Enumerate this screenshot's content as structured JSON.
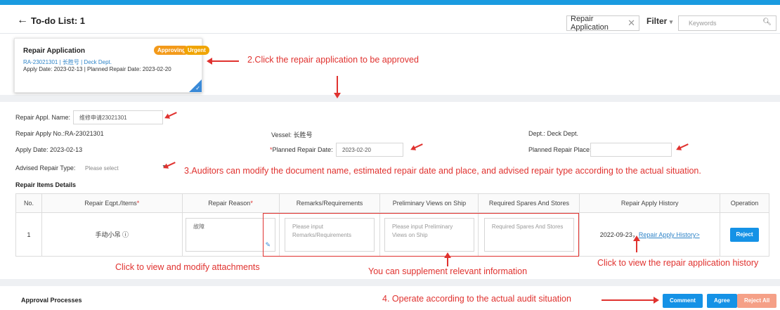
{
  "header": {
    "back_label": "To-do List: 1",
    "filter_chip": "Repair Application",
    "filter_label": "Filter",
    "keywords_placeholder": "Keywords"
  },
  "card": {
    "title": "Repair Application",
    "badge_approving": "Approving",
    "badge_urgent": "Urgent",
    "line2": "RA-23021301  |  长胜号  |  Deck Dept.",
    "line3": "Apply Date: 2023-02-13 | Planned Repair Date: 2023-02-20"
  },
  "annotations": {
    "step2": "2.Click the repair application to be approved",
    "step3": "3.Auditors can modify the document name, estimated repair date and place, and advised repair type according to the actual situation.",
    "attachments": "Click to view and modify attachments",
    "supplement": "You can supplement relevant information",
    "history": "Click to view the repair application history",
    "step4": "4. Operate according to the actual audit situation"
  },
  "form": {
    "appl_name_label": "Repair Appl. Name:",
    "appl_name_value": "维修申请23021301",
    "apply_no_label": "Repair Apply No.:",
    "apply_no_value": "RA-23021301",
    "vessel_label": "Vessel:",
    "vessel_value": "长胜号",
    "dept_label": "Dept.:",
    "dept_value": "Deck Dept.",
    "apply_date_label": "Apply Date:",
    "apply_date_value": "2023-02-13",
    "planned_date_label": "Planned Repair Date:",
    "planned_date_value": "2023-02-20",
    "planned_place_label": "Planned Repair Place:",
    "planned_place_value": "",
    "advised_type_label": "Advised Repair Type:",
    "advised_type_value": "Please select"
  },
  "items_section": {
    "title": "Repair Items Details",
    "columns": [
      "No.",
      "Repair Eqpt./Items",
      "Repair Reason",
      "Remarks/Requirements",
      "Preliminary Views on Ship",
      "Required Spares And Stores",
      "Repair Apply History",
      "Operation"
    ],
    "row": {
      "no": "1",
      "item": "手动小吊 ⓘ",
      "reason": "故障",
      "remarks_placeholder": "Please input Remarks/Requirements",
      "views_placeholder": "Please input Preliminary Views on Ship",
      "spares_placeholder": "Required Spares And Stores",
      "history_date": "2022-09-23，",
      "history_link": "Repair Apply History>",
      "operation": "Reject"
    }
  },
  "approval": {
    "title": "Approval Processes",
    "comment": "Comment",
    "agree": "Agree",
    "reject_all": "Reject All"
  },
  "colors": {
    "accent": "#1592e6",
    "annotation": "#e0322f",
    "badge_approving": "#f39a1a",
    "reject_all": "#f5a087"
  }
}
